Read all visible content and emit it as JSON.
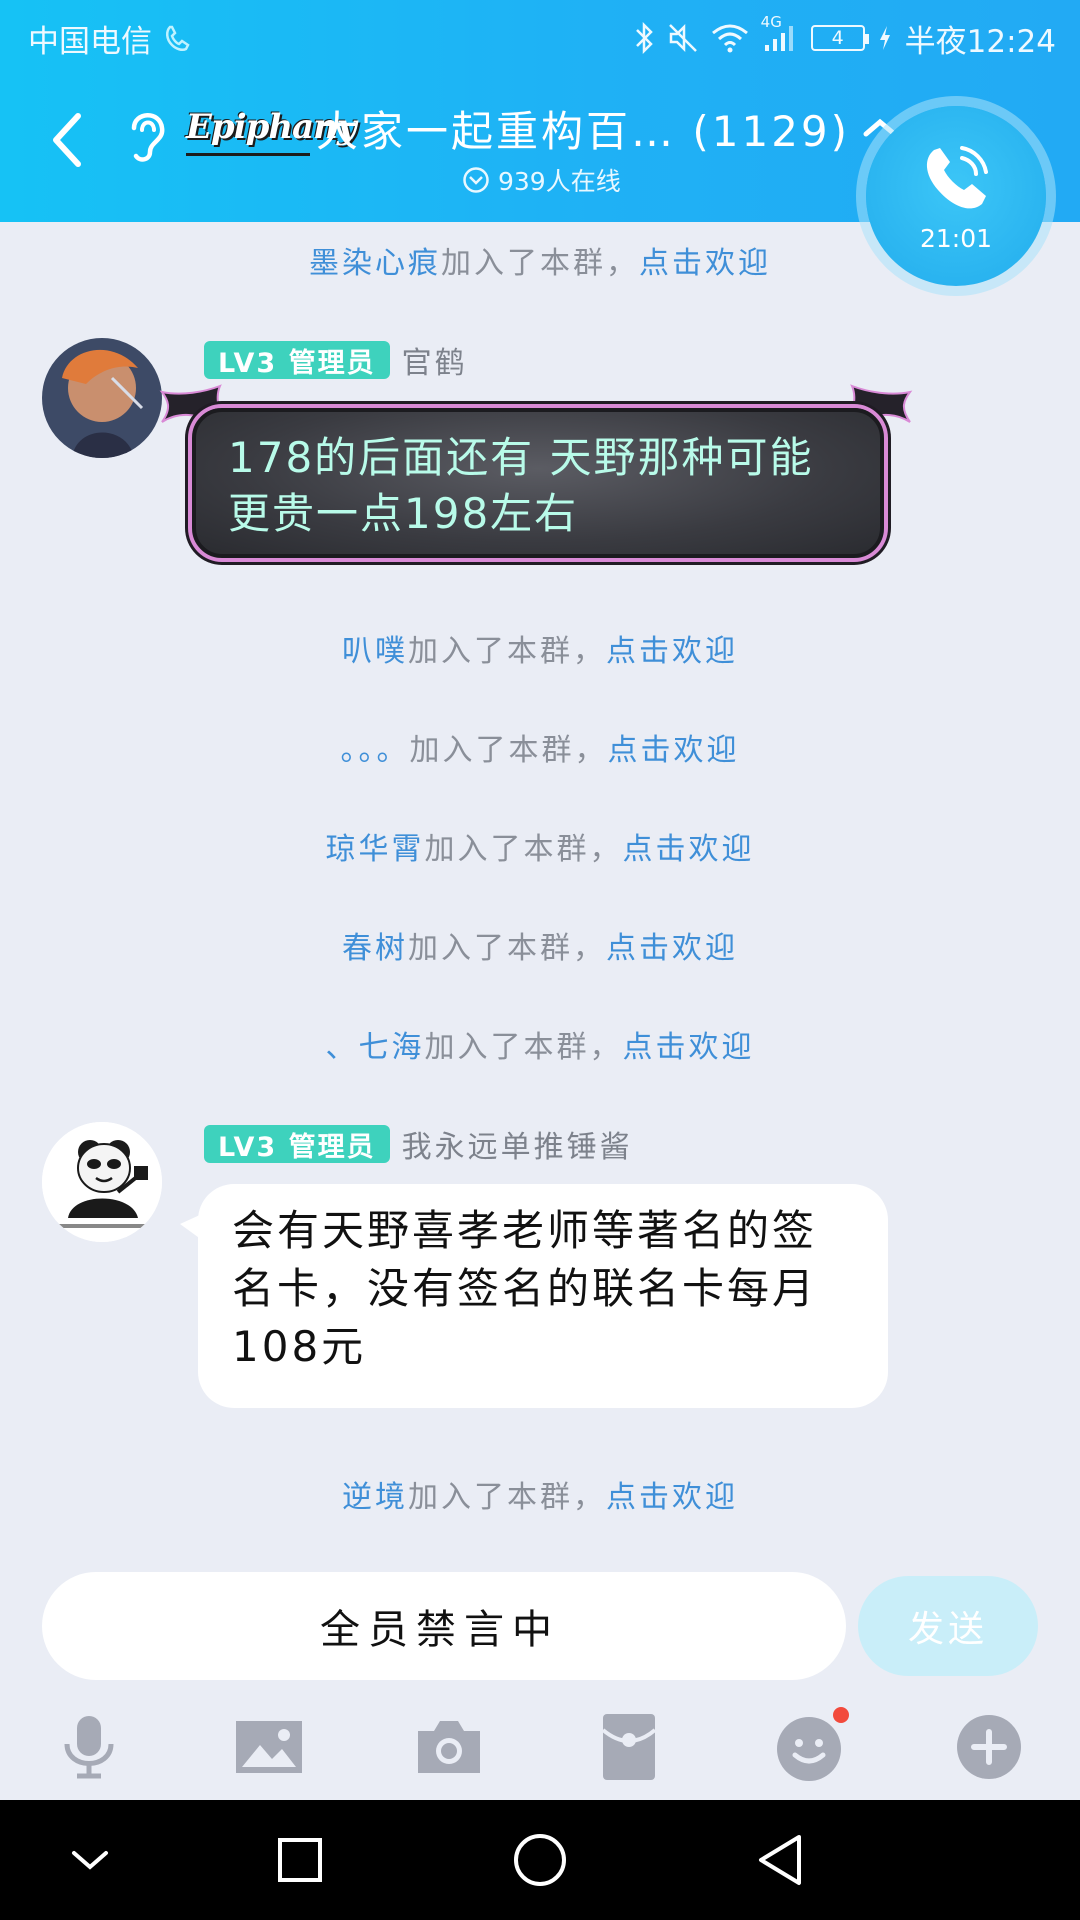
{
  "status_bar": {
    "carrier": "中国电信",
    "network": "4G",
    "battery": "4",
    "time": "半夜12:24"
  },
  "header": {
    "logo_text": "Epiphany",
    "group_name": "大家一起重构百…",
    "member_count": "(1129)",
    "online_text": "939人在线"
  },
  "call": {
    "duration": "21:01"
  },
  "messages": {
    "join1": {
      "nick": "墨染心痕",
      "text": "加入了本群，",
      "welcome": "点击欢迎"
    },
    "msg1": {
      "badge": "LV3 管理员",
      "sender": "官鹤",
      "text": "178的后面还有 天野那种可能更贵一点198左右"
    },
    "join2": {
      "nick": "叭噗",
      "text": "加入了本群，",
      "welcome": "点击欢迎"
    },
    "join3": {
      "nick": "。。。",
      "text": "加入了本群，",
      "welcome": "点击欢迎"
    },
    "join4": {
      "nick": "琼华霄",
      "text": "加入了本群，",
      "welcome": "点击欢迎"
    },
    "join5": {
      "nick": "春树",
      "text": "加入了本群，",
      "welcome": "点击欢迎"
    },
    "join6": {
      "nick": "、七海",
      "text": "加入了本群，",
      "welcome": "点击欢迎"
    },
    "msg2": {
      "badge": "LV3 管理员",
      "sender": "我永远单推锤酱",
      "text": "会有天野喜孝老师等著名的签名卡，没有签名的联名卡每月108元"
    },
    "join7": {
      "nick": "逆境",
      "text": "加入了本群，",
      "welcome": "点击欢迎"
    }
  },
  "input": {
    "muted_text": "全员禁言中",
    "send_label": "发送"
  },
  "toolbar": {
    "icons": [
      "mic-icon",
      "image-icon",
      "camera-icon",
      "red-packet-icon",
      "emoji-icon",
      "plus-icon"
    ]
  },
  "colors": {
    "header": "#1fb1f5",
    "badge": "#3ed2bd",
    "link": "#3f8fd8",
    "background": "#eaedf5"
  }
}
